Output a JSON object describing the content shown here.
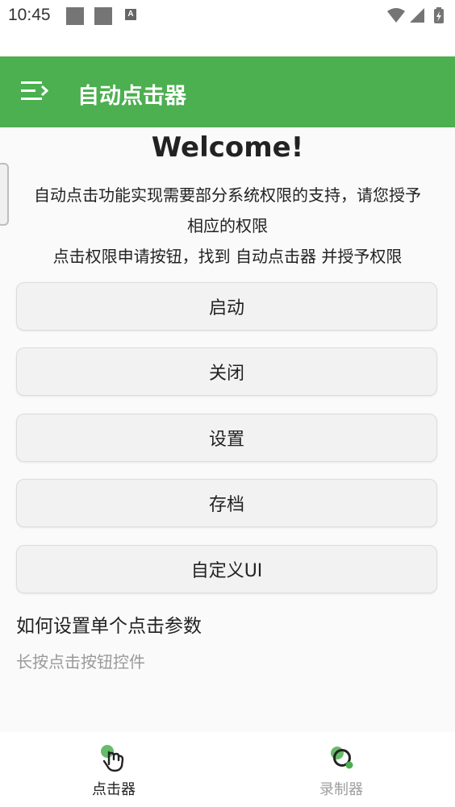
{
  "status_bar": {
    "time": "10:45",
    "notification_a": "A"
  },
  "app_bar": {
    "title": "自动点击器"
  },
  "main": {
    "welcome": "Welcome!",
    "description_lines": [
      "自动点击功能实现需要部分系统权限的支持，请您授予",
      "相应的权限",
      "点击权限申请按钮，找到 自动点击器 并授予权限"
    ],
    "buttons": [
      "启动",
      "关闭",
      "设置",
      "存档",
      "自定义UI"
    ],
    "help_title": "如何设置单个点击参数",
    "help_desc": "长按点击按钮控件"
  },
  "bottom_nav": {
    "items": [
      {
        "label": "点击器",
        "icon": "tap-hand-icon",
        "selected": true
      },
      {
        "label": "录制器",
        "icon": "recorder-icon",
        "selected": false
      }
    ]
  },
  "colors": {
    "accent": "#4caf50",
    "selected_label": "#222222",
    "unselected_label": "#9e9e9e"
  }
}
